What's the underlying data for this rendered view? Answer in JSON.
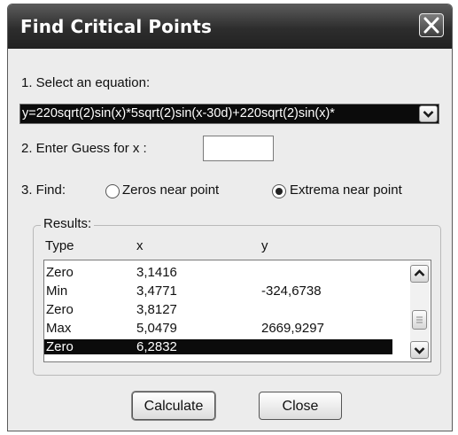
{
  "window": {
    "title": "Find Critical Points"
  },
  "step1": {
    "label": "1. Select an equation:",
    "equation": "y=220sqrt(2)sin(x)*5sqrt(2)sin(x-30d)+220sqrt(2)sin(x)*"
  },
  "step2": {
    "label": "2. Enter Guess for  x :",
    "value": ""
  },
  "step3": {
    "label": "3. Find:",
    "option_zeros": "Zeros near point",
    "option_extrema": "Extrema near point",
    "selected": "Extrema near point"
  },
  "results": {
    "title": "Results:",
    "columns": [
      "Type",
      "x",
      "y"
    ],
    "rows": [
      {
        "type": "Zero",
        "x": "3,1416",
        "y": ""
      },
      {
        "type": "Min",
        "x": "3,4771",
        "y": "-324,6738"
      },
      {
        "type": "Zero",
        "x": "3,8127",
        "y": ""
      },
      {
        "type": "Max",
        "x": "5,0479",
        "y": "2669,9297"
      },
      {
        "type": "Zero",
        "x": "6,2832",
        "y": ""
      }
    ],
    "selected_row": 4
  },
  "buttons": {
    "calculate": "Calculate",
    "close": "Close"
  },
  "icons": {
    "close": "close-icon",
    "dropdown": "chevron-down-icon",
    "scroll_up": "chevron-up-icon",
    "scroll_down": "chevron-down-icon"
  }
}
